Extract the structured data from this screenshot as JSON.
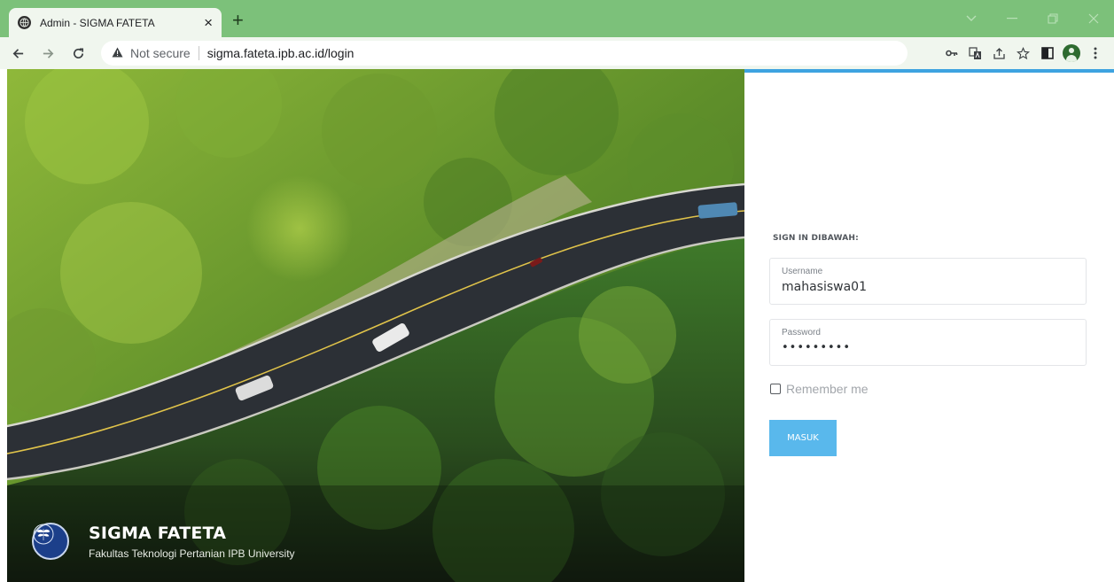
{
  "browser": {
    "tab_title": "Admin - SIGMA FATETA",
    "tab_close": "×",
    "new_tab": "+",
    "security_label": "Not secure",
    "url": "sigma.fateta.ipb.ac.id/login",
    "accent_color": "#7cc17a",
    "icons": [
      "back-icon",
      "forward-icon",
      "reload-icon",
      "warning-icon",
      "key-icon",
      "translate-icon",
      "share-icon",
      "star-icon",
      "side-panel-icon",
      "profile-icon",
      "menu-icon"
    ]
  },
  "hero": {
    "brand_title": "SIGMA FATETA",
    "brand_subtitle": "Fakultas Teknologi Pertanian IPB University"
  },
  "login": {
    "heading": "SIGN IN DIBAWAH:",
    "username_label": "Username",
    "username_value": "mahasiswa01",
    "password_label": "Password",
    "password_value": "•••••••••",
    "remember_label": "Remember me",
    "remember_checked": false,
    "submit_label": "MASUK",
    "button_color": "#59b8ec",
    "accent_color": "#3ea3e0"
  }
}
